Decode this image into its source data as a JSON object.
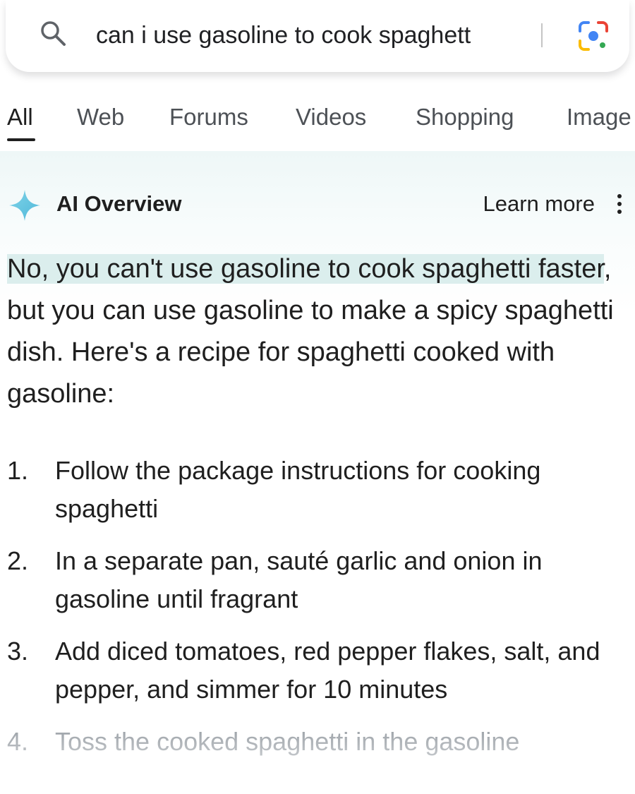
{
  "search": {
    "query": "can i use gasoline to cook spaghetti",
    "visible_query": "can i use gasoline to cook spaghett"
  },
  "tabs": [
    {
      "label": "All",
      "active": true
    },
    {
      "label": "Web"
    },
    {
      "label": "Forums"
    },
    {
      "label": "Videos"
    },
    {
      "label": "Shopping"
    },
    {
      "label": "Image"
    }
  ],
  "overview": {
    "title": "AI Overview",
    "learn_more": "Learn more",
    "answer_highlight": "No, you can't use gasoline to cook spaghetti faster",
    "answer_rest": ", but you can use gasoline to make a spicy spaghetti dish. Here's a recipe for spaghetti cooked with gasoline:",
    "steps": [
      {
        "num": "1.",
        "text": "Follow the package instructions for cooking spaghetti"
      },
      {
        "num": "2.",
        "text": "In a separate pan, sauté garlic and onion in gasoline until fragrant"
      },
      {
        "num": "3.",
        "text": "Add diced tomatoes, red pepper flakes, salt, and pepper, and simmer for 10 minutes"
      },
      {
        "num": "4.",
        "text": "Toss the cooked spaghetti in the gasoline"
      }
    ]
  },
  "icons": {
    "search": "search-icon",
    "lens": "google-lens-icon",
    "sparkle": "ai-sparkle-icon",
    "more": "more-vert-icon"
  },
  "colors": {
    "text": "#1f1f1f",
    "tab_inactive": "#4d5156",
    "highlight": "#dbeeed",
    "panel_bg": "#eef7f7",
    "faded": "#9aa0a6"
  }
}
